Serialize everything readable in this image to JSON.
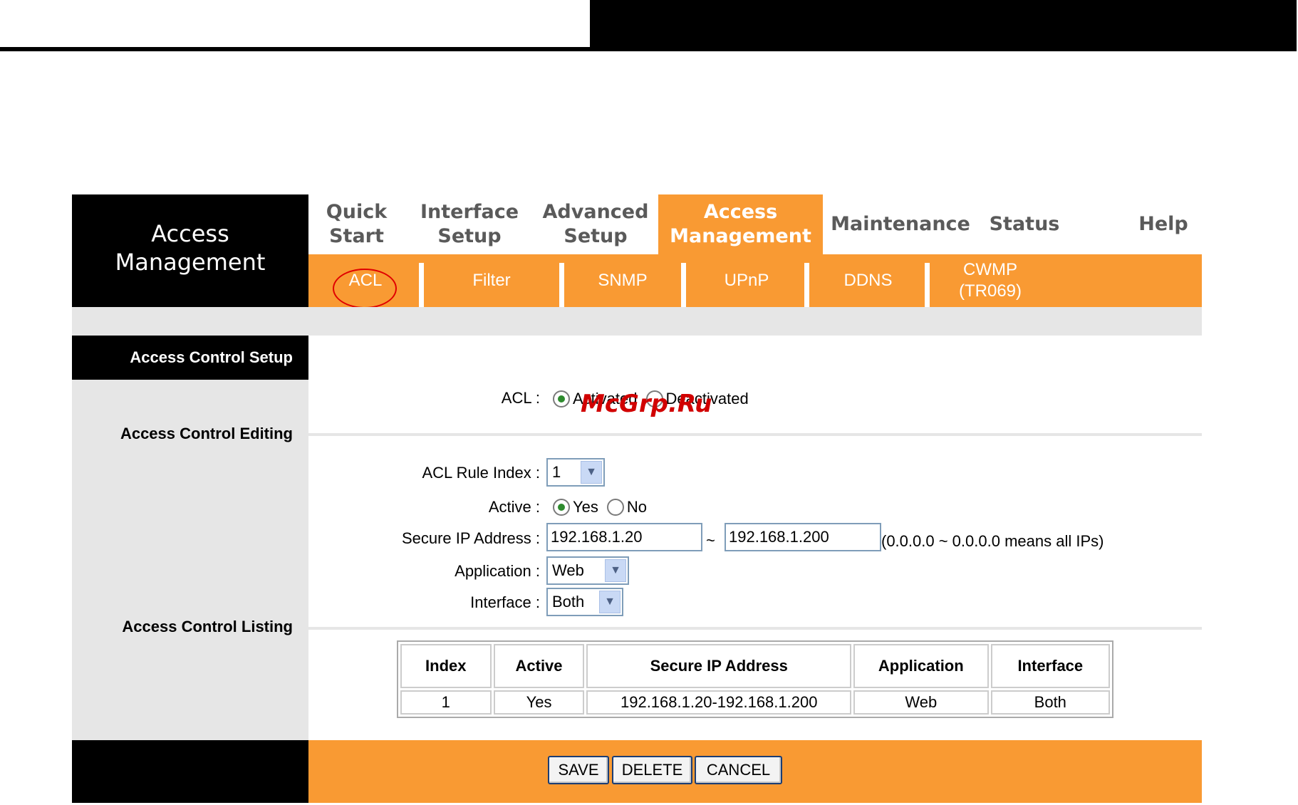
{
  "nav": {
    "section_title_line1": "Access",
    "section_title_line2": "Management",
    "main_tabs": [
      {
        "line1": "Quick",
        "line2": "Start"
      },
      {
        "line1": "Interface",
        "line2": "Setup"
      },
      {
        "line1": "Advanced",
        "line2": "Setup"
      },
      {
        "line1": "Access",
        "line2": "Management"
      },
      {
        "line1": "Maintenance",
        "line2": ""
      },
      {
        "line1": "Status",
        "line2": ""
      },
      {
        "line1": "Help",
        "line2": ""
      }
    ],
    "active_main_tab": "Access Management",
    "sub_tabs": [
      {
        "line1": "ACL",
        "line2": ""
      },
      {
        "line1": "Filter",
        "line2": ""
      },
      {
        "line1": "SNMP",
        "line2": ""
      },
      {
        "line1": "UPnP",
        "line2": ""
      },
      {
        "line1": "DDNS",
        "line2": ""
      },
      {
        "line1": "CWMP",
        "line2": "(TR069)"
      }
    ]
  },
  "sections": {
    "setup": "Access Control Setup",
    "editing": "Access Control Editing",
    "listing": "Access Control Listing"
  },
  "acl_setup": {
    "label": "ACL :",
    "options": [
      "Activated",
      "Deactivated"
    ],
    "selected": "Activated"
  },
  "editing": {
    "rule_index_label": "ACL Rule Index :",
    "rule_index_value": "1",
    "active_label": "Active :",
    "active_options": [
      "Yes",
      "No"
    ],
    "active_selected": "Yes",
    "secure_ip_label": "Secure IP Address :",
    "ip_start": "192.168.1.20",
    "ip_separator": "~",
    "ip_end": "192.168.1.200",
    "ip_hint": "(0.0.0.0 ~ 0.0.0.0 means all IPs)",
    "application_label": "Application :",
    "application_value": "Web",
    "interface_label": "Interface :",
    "interface_value": "Both"
  },
  "listing": {
    "columns": [
      "Index",
      "Active",
      "Secure IP Address",
      "Application",
      "Interface"
    ],
    "rows": [
      [
        "1",
        "Yes",
        "192.168.1.20-192.168.1.200",
        "Web",
        "Both"
      ]
    ]
  },
  "buttons": {
    "save": "SAVE",
    "delete": "DELETE",
    "cancel": "CANCEL"
  },
  "watermark": "McGrp.Ru",
  "colors": {
    "accent_orange": "#f99a33",
    "panel_grey": "#e6e6e6",
    "header_black": "#000000"
  }
}
